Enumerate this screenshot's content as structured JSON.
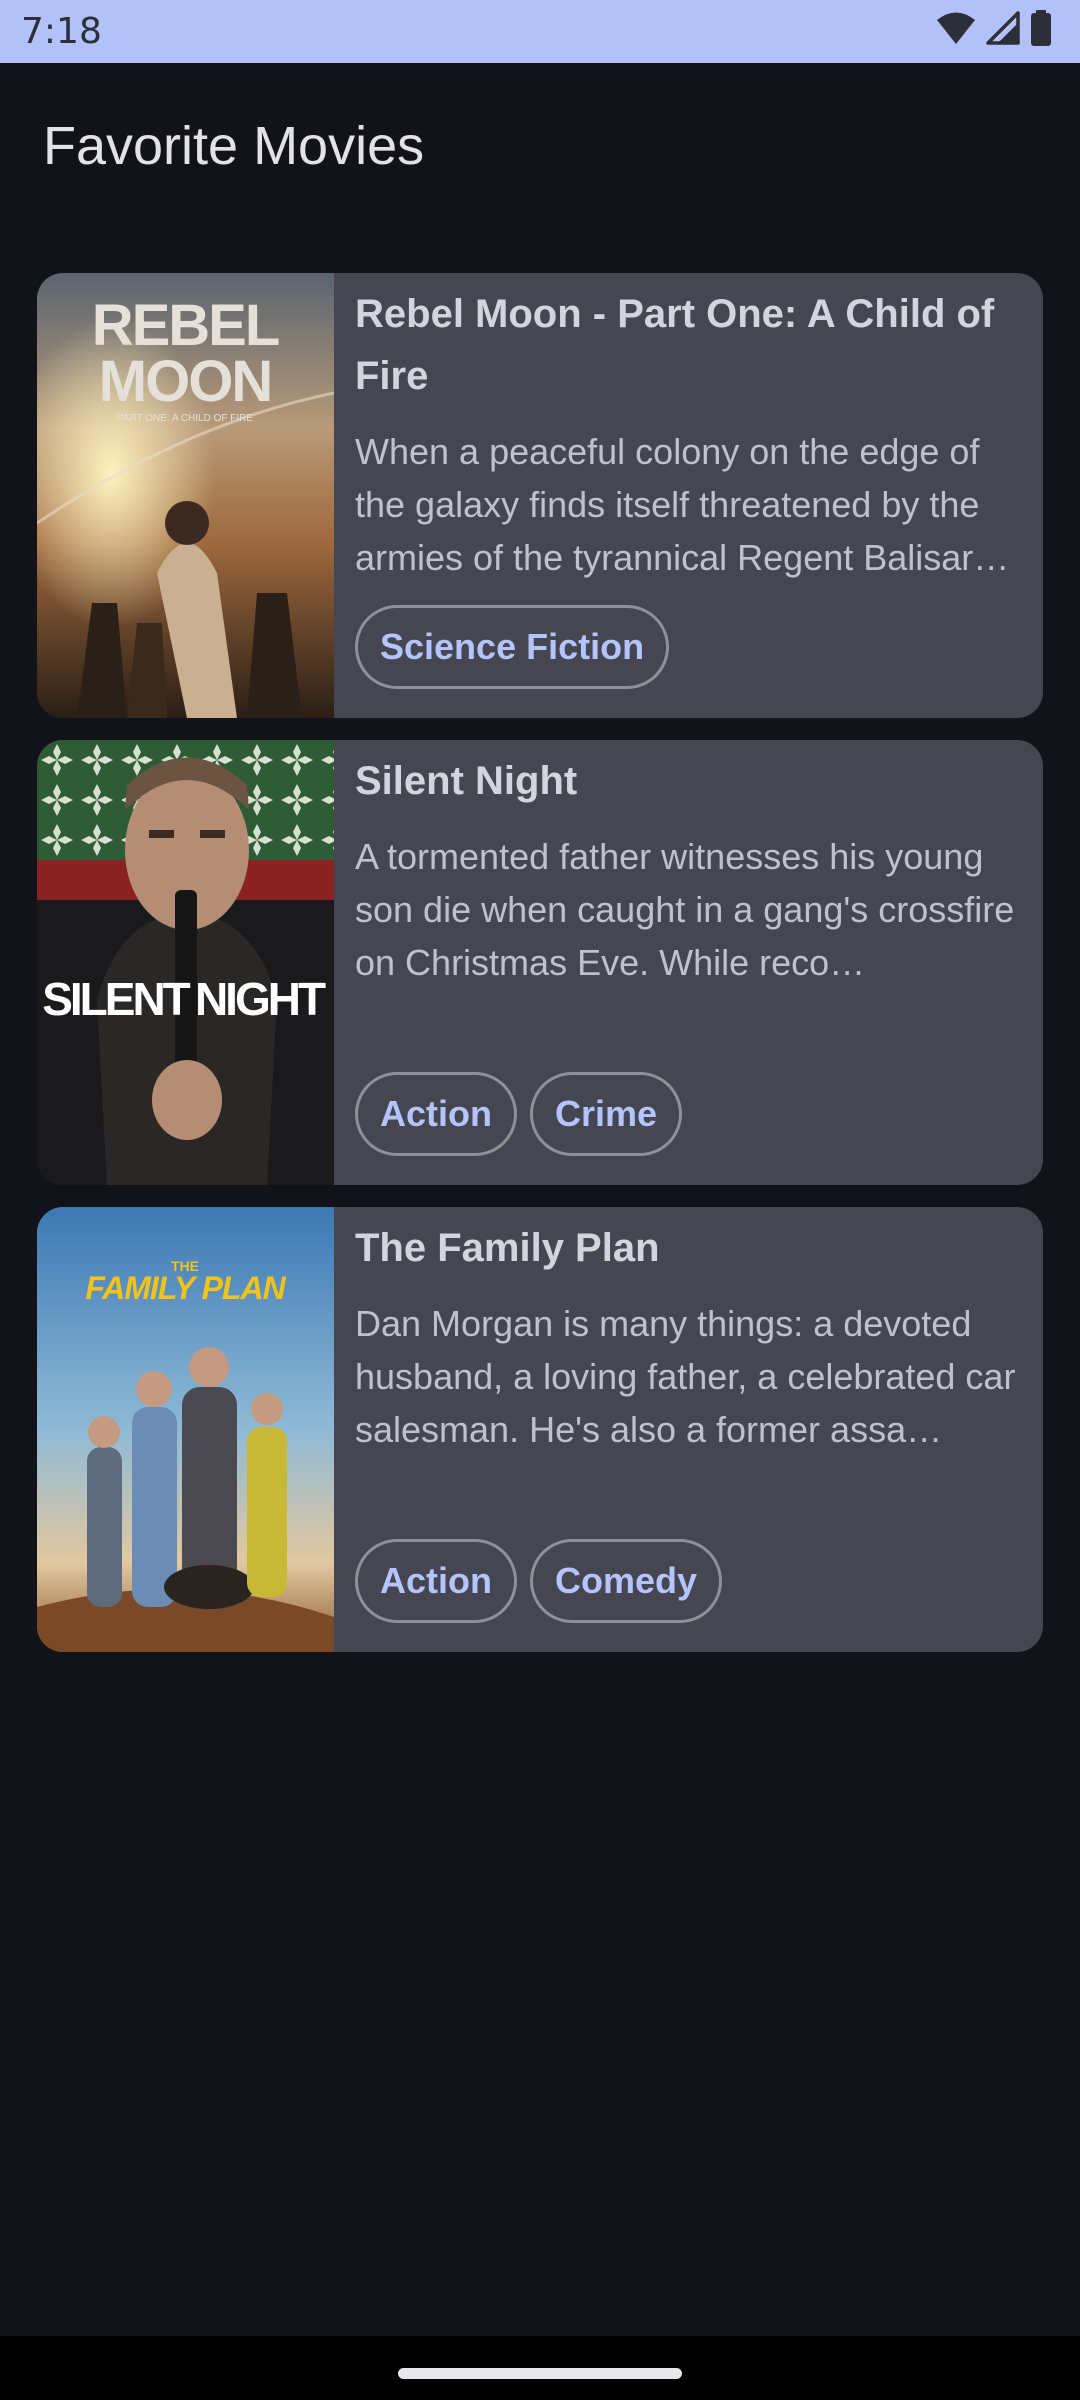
{
  "status_bar": {
    "time": "7:18",
    "icons": [
      "wifi-icon",
      "cell-signal-icon",
      "battery-icon"
    ]
  },
  "page": {
    "title": "Favorite Movies"
  },
  "movies": [
    {
      "title": "Rebel Moon - Part One: A Child of Fire",
      "description": "When a peaceful colony on the edge of the galaxy finds itself threatened by the armies of the tyrannical Regent Balisar…",
      "genres": [
        "Science Fiction"
      ],
      "poster_text": [
        "REBEL",
        "MOON",
        "PART ONE: A CHILD OF FIRE"
      ]
    },
    {
      "title": "Silent Night",
      "description": "A tormented father witnesses his young son die when caught in a gang's crossfire on Christmas Eve. While reco…",
      "genres": [
        "Action",
        "Crime"
      ],
      "poster_text": [
        "SILENT",
        "NIGHT"
      ]
    },
    {
      "title": "The Family Plan",
      "description": "Dan Morgan is many things: a devoted husband, a loving father, a celebrated car salesman. He's also a former assa…",
      "genres": [
        "Action",
        "Comedy"
      ],
      "poster_text": [
        "THE",
        "FAMILY PLAN"
      ]
    }
  ],
  "colors": {
    "background": "#121318",
    "status_bar": "#b3c1f9",
    "card": "#45464f",
    "chip_text": "#b3c4ff"
  }
}
